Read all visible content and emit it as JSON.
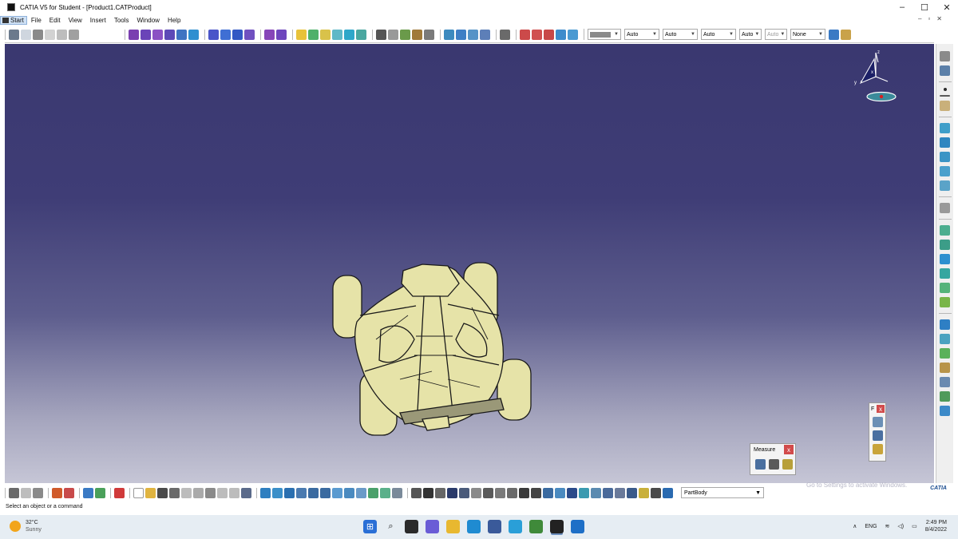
{
  "window": {
    "title": "CATIA V5 for Student - [Product1.CATProduct]",
    "controls": [
      "–",
      "☐",
      "✕"
    ]
  },
  "menu": {
    "items": [
      "Start",
      "File",
      "Edit",
      "View",
      "Insert",
      "Tools",
      "Window",
      "Help"
    ],
    "mdi_controls": [
      "–",
      "▫",
      "✕"
    ]
  },
  "toolbar": {
    "color_combo": "",
    "combos": [
      "Auto",
      "Auto",
      "Auto",
      "Auto",
      "Auto"
    ],
    "line_style": "None"
  },
  "compass": {
    "x_label": "x",
    "y_label": "y",
    "z_label": "z"
  },
  "measure_panel": {
    "title": "Measure",
    "close_label": "x"
  },
  "float_panel": {
    "title": "F",
    "close_label": "x"
  },
  "watermark": "Go to Settings to activate Windows.",
  "bottom_toolbar": {
    "body_select": "PartBody"
  },
  "status": {
    "text": "Select an object or a command"
  },
  "taskbar": {
    "weather_temp": "32°C",
    "weather_condition": "Sunny",
    "language": "ENG",
    "time": "2:49 PM",
    "date": "8/4/2022"
  },
  "brand": {
    "logo_text": "CATIA"
  },
  "colors": {
    "background_top": "#3a3870",
    "background_bottom": "#c6c6d6",
    "model": "#e6e3a8",
    "accent": "#1a4c8f"
  }
}
